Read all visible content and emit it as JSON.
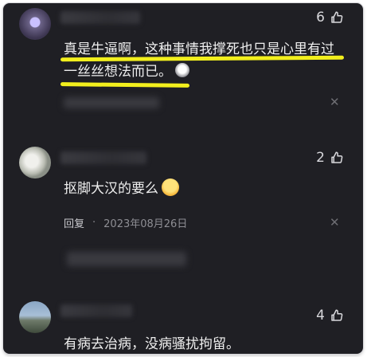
{
  "comments": [
    {
      "likes": "6",
      "line1": "真是牛逼啊，这种事情我撑死也只是心里有过",
      "line2": "一丝丝想法而已。"
    },
    {
      "likes": "2",
      "text": "抠脚大汉的要么",
      "reply": "回复",
      "dot": "·",
      "date": "2023年08月26日"
    },
    {
      "likes": "4",
      "text": "有病去治病，没病骚扰拘留。"
    }
  ],
  "icons": {
    "like": "thumbs-up-icon",
    "dismiss": "close-icon"
  },
  "colors": {
    "background": "#1f1f24",
    "highlight": "#f2ef1d"
  }
}
